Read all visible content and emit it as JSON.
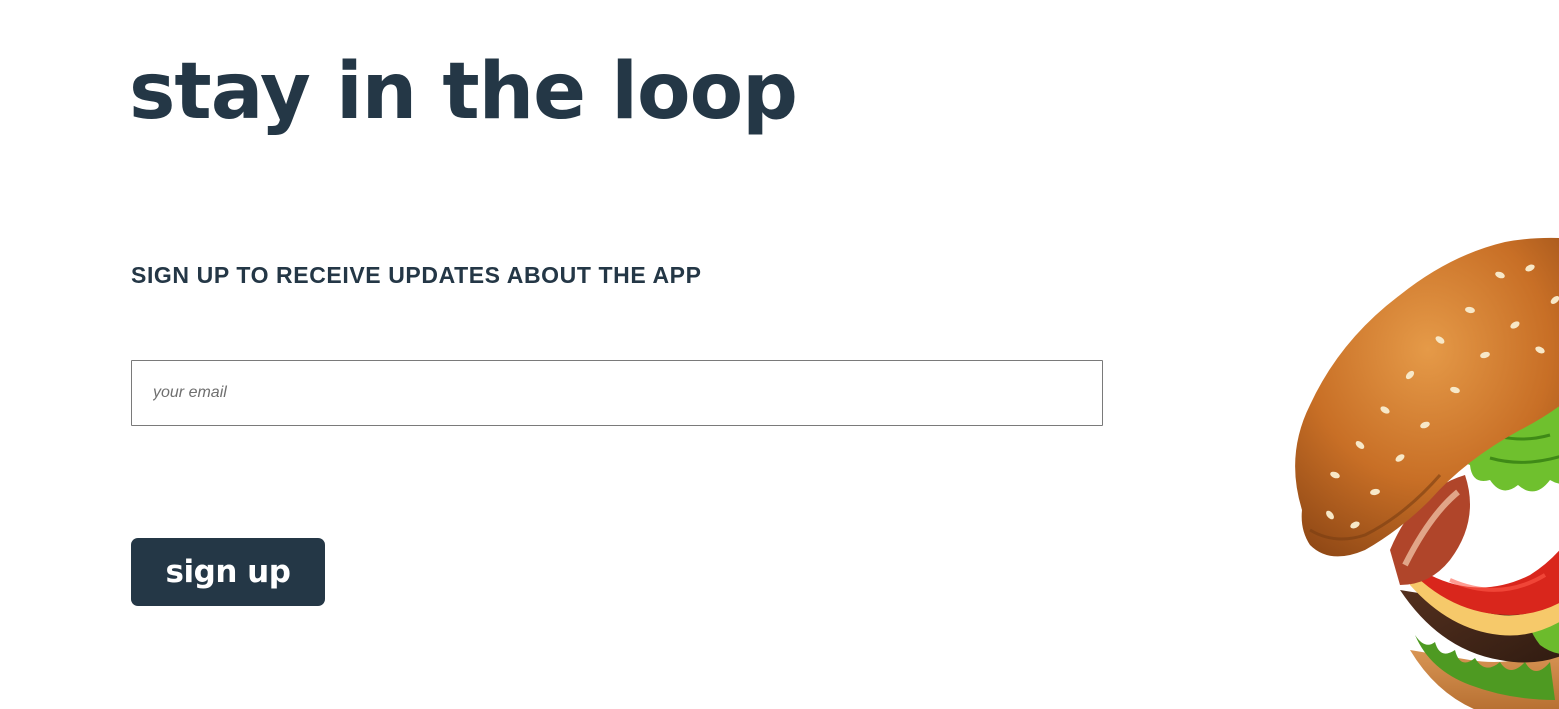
{
  "heading": "stay in the loop",
  "subheading": "SIGN UP TO RECEIVE UPDATES ABOUT THE APP",
  "form": {
    "email_placeholder": "your email",
    "email_value": "",
    "submit_label": "sign up"
  },
  "colors": {
    "primary": "#243746",
    "background": "#ffffff",
    "input_border": "#7a7a7a"
  },
  "image": {
    "subject": "burger-image"
  }
}
